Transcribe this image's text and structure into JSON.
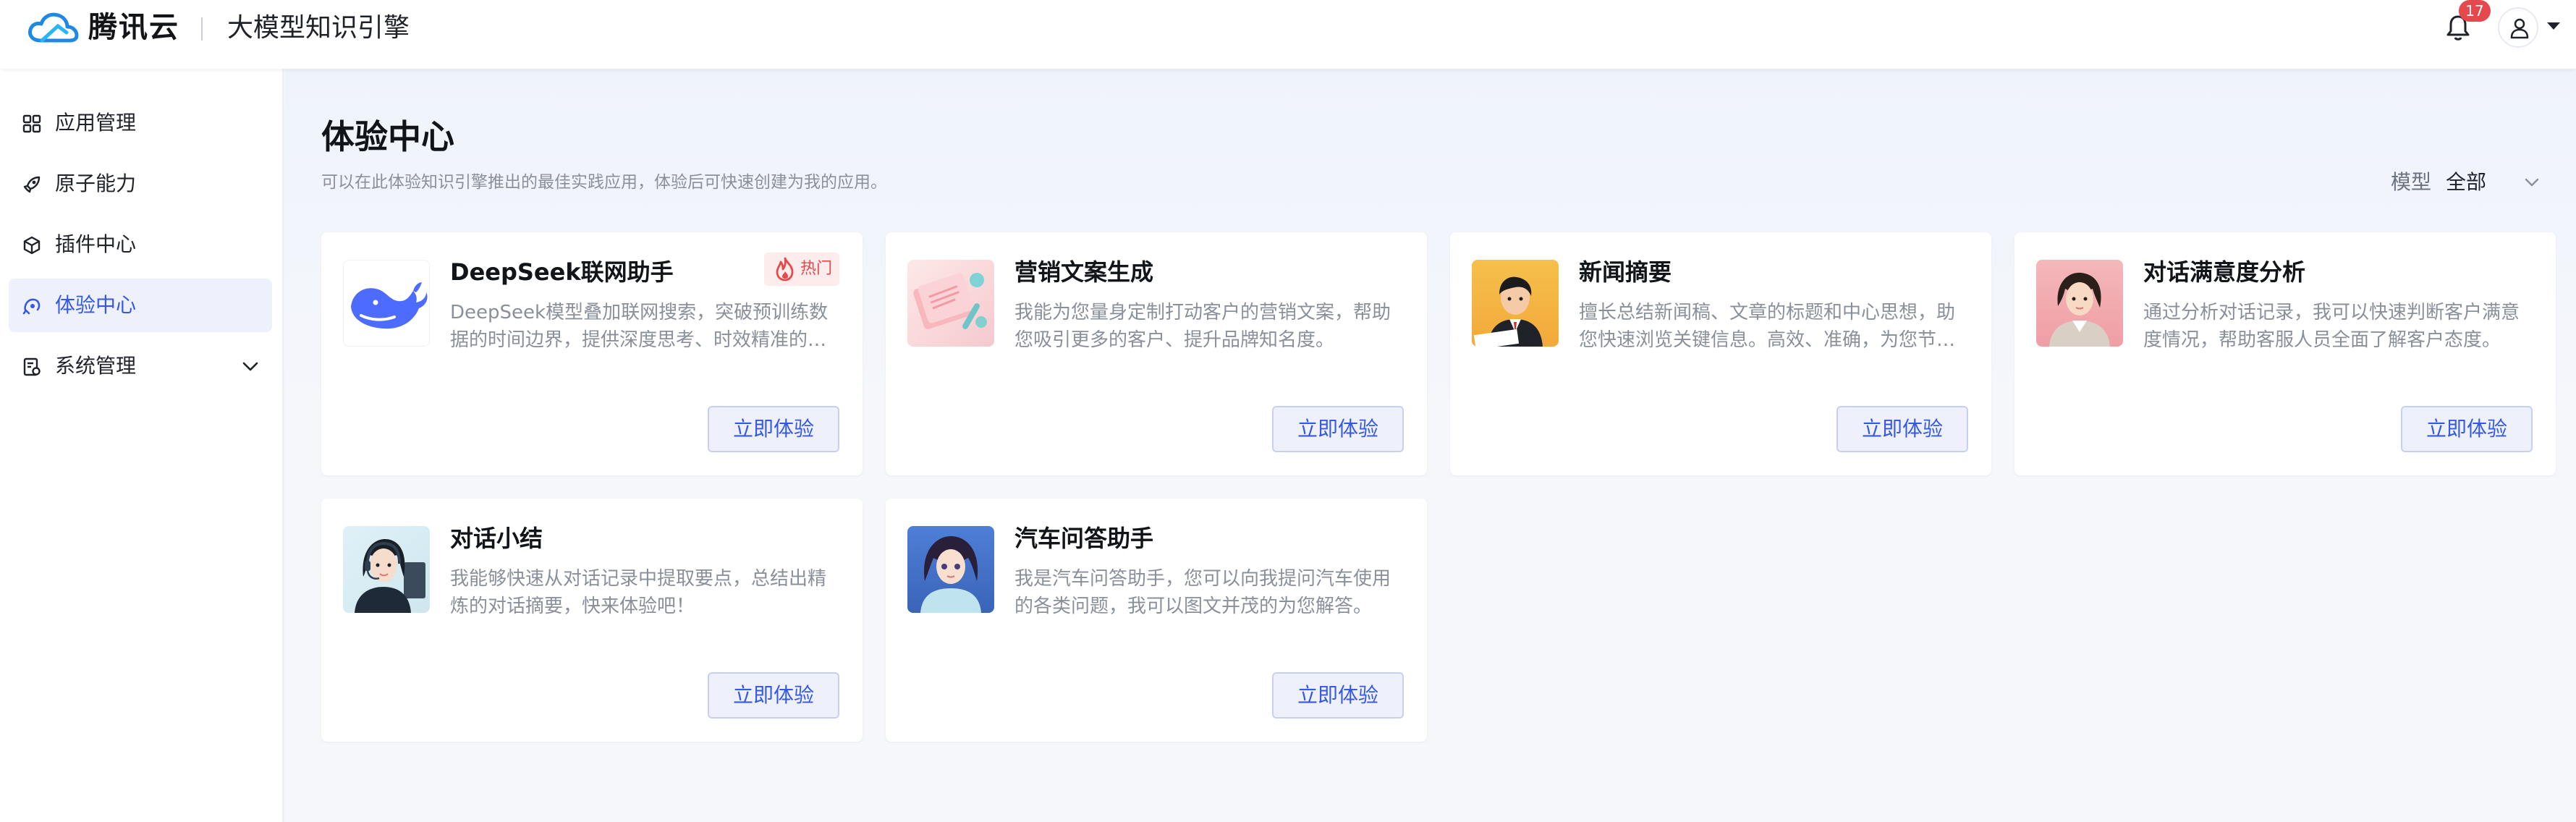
{
  "header": {
    "brand": "腾讯云",
    "product": "大模型知识引擎",
    "notifications_count": "17"
  },
  "sidebar": {
    "items": [
      {
        "label": "应用管理",
        "icon": "grid-icon"
      },
      {
        "label": "原子能力",
        "icon": "rocket-icon"
      },
      {
        "label": "插件中心",
        "icon": "cube-icon"
      },
      {
        "label": "体验中心",
        "icon": "experience-icon",
        "active": true
      },
      {
        "label": "系统管理",
        "icon": "system-icon",
        "expandable": true
      }
    ]
  },
  "main": {
    "title": "体验中心",
    "subtitle": "可以在此体验知识引擎推出的最佳实践应用，体验后可快速创建为我的应用。",
    "filter": {
      "label": "模型",
      "value": "全部"
    },
    "cards": [
      {
        "title": "DeepSeek联网助手",
        "description": "DeepSeek模型叠加联网搜索，突破预训练数据的时间边界，提供深度思考、时效精准的回答。",
        "button": "立即体验",
        "tag": "热门",
        "thumb": "deepseek-whale-logo"
      },
      {
        "title": "营销文案生成",
        "description": "我能为您量身定制打动客户的营销文案，帮助您吸引更多的客户、提升品牌知名度。",
        "button": "立即体验",
        "thumb": "marketing-notebook-image"
      },
      {
        "title": "新闻摘要",
        "description": "擅长总结新闻稿、文章的标题和中心思想，助您快速浏览关键信息。高效、准确，为您节省时间。",
        "button": "立即体验",
        "thumb": "news-reader-image"
      },
      {
        "title": "对话满意度分析",
        "description": "通过分析对话记录，我可以快速判断客户满意度情况，帮助客服人员全面了解客户态度。",
        "button": "立即体验",
        "thumb": "satisfaction-agent-image"
      },
      {
        "title": "对话小结",
        "description": "我能够快速从对话记录中提取要点，总结出精炼的对话摘要，快来体验吧！",
        "button": "立即体验",
        "thumb": "headset-agent-image"
      },
      {
        "title": "汽车问答助手",
        "description": "我是汽车问答助手，您可以向我提问汽车使用的各类问题，我可以图文并茂的为您解答。",
        "button": "立即体验",
        "thumb": "car-assistant-image"
      }
    ]
  },
  "colors": {
    "accent": "#3559e6",
    "active_bg": "#eef1fc",
    "hot": "#e5484d"
  }
}
